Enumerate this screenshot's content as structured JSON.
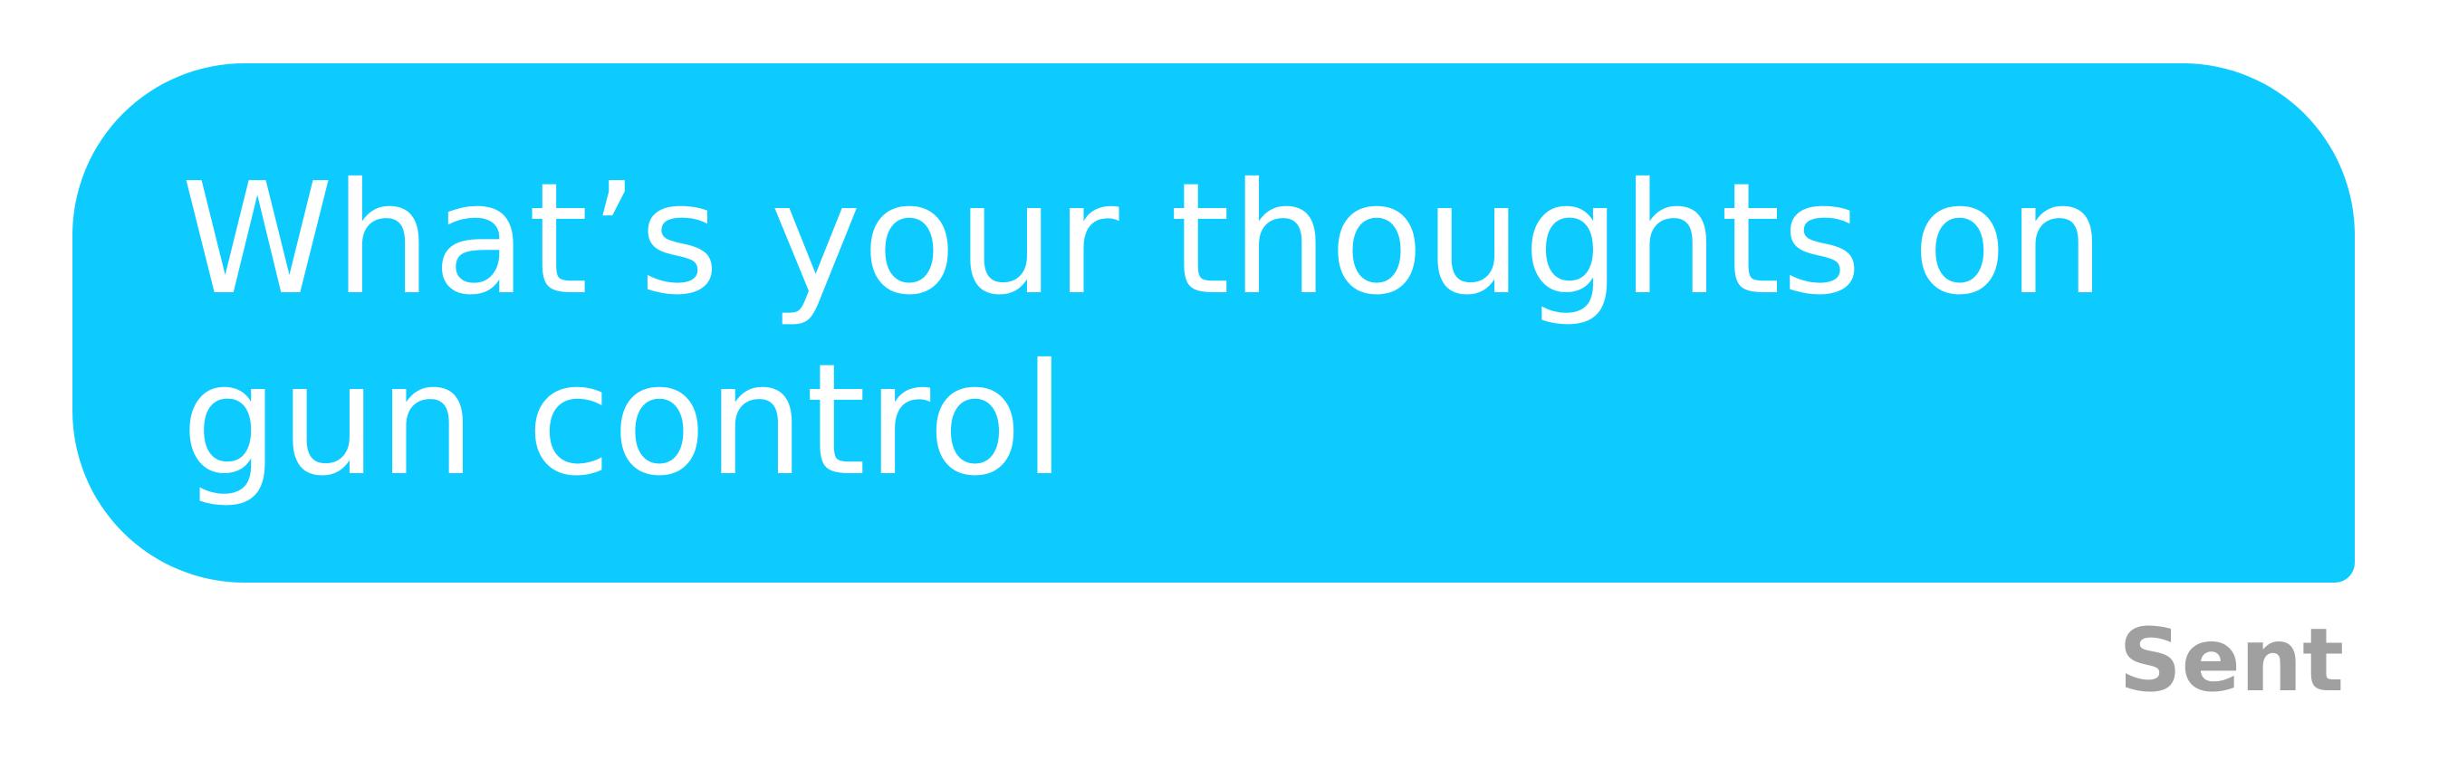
{
  "message": {
    "text": "What’s your thoughts on gun control",
    "bubble_color": "#0ECBFF",
    "text_color": "#FFFFFF"
  },
  "status": {
    "label": "Sent",
    "color": "#A0A0A0"
  }
}
